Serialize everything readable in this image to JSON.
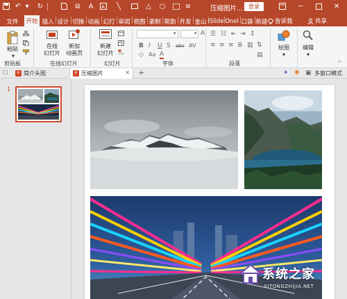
{
  "titlebar": {
    "doc_title": "压缩图片...",
    "login_label": "登录",
    "quick_access_icons": [
      "save-icon",
      "undo-icon",
      "redo-icon",
      "new-icon",
      "print-preview-icon",
      "text-icon",
      "text-box-icon",
      "rectangle-icon",
      "triangle-icon",
      "circle-icon",
      "dashed-rect-icon",
      "more-icon"
    ],
    "window_controls": [
      "restore-ribbon-icon",
      "minimize-icon",
      "maximize-icon",
      "close-icon"
    ]
  },
  "ribbon_tabs": {
    "items": [
      {
        "label": "文件"
      },
      {
        "label": "开始",
        "active": true
      },
      {
        "label": "插入"
      },
      {
        "label": "设计"
      },
      {
        "label": "切换"
      },
      {
        "label": "动画"
      },
      {
        "label": "幻灯"
      },
      {
        "label": "审阅"
      },
      {
        "label": "视图"
      },
      {
        "label": "录制"
      },
      {
        "label": "帮助"
      },
      {
        "label": "开发"
      },
      {
        "label": "金山"
      },
      {
        "label": "iSlide"
      },
      {
        "label": "OneI"
      },
      {
        "label": "口袋"
      },
      {
        "label": "新建"
      }
    ],
    "tell_me": "告诉我",
    "share": "共享"
  },
  "ribbon": {
    "clipboard": {
      "paste": "粘贴",
      "group": "剪贴板"
    },
    "slides_new": {
      "new_window": "在线\n幻灯片",
      "new_anim": "新加\n动画页",
      "group": "在线幻灯片"
    },
    "slides": {
      "new_slide": "新建\n幻灯片",
      "group": "幻灯片"
    },
    "font": {
      "group": "字体",
      "bold": "B",
      "italic": "I",
      "underline": "U",
      "strike": "S",
      "shadow": "abc",
      "spacing": "AV",
      "case": "Aa",
      "color": "A"
    },
    "paragraph": {
      "group": "段落"
    },
    "drawing": {
      "label": "绘图"
    },
    "editing": {
      "label": "编辑"
    }
  },
  "doc_tabs": {
    "items": [
      {
        "label": "简介头图"
      },
      {
        "label": "压缩图片",
        "active": true
      }
    ],
    "mode_label": "多窗口模式"
  },
  "thumbnails": [
    {
      "number": "1"
    }
  ],
  "watermark": {
    "text": "系统之家",
    "url": "XITONGZHIJIA.NET"
  },
  "colors": {
    "accent": "#b7472a",
    "ribbon_bg": "#f5f5f5",
    "thumb_border": "#d04a2c"
  }
}
